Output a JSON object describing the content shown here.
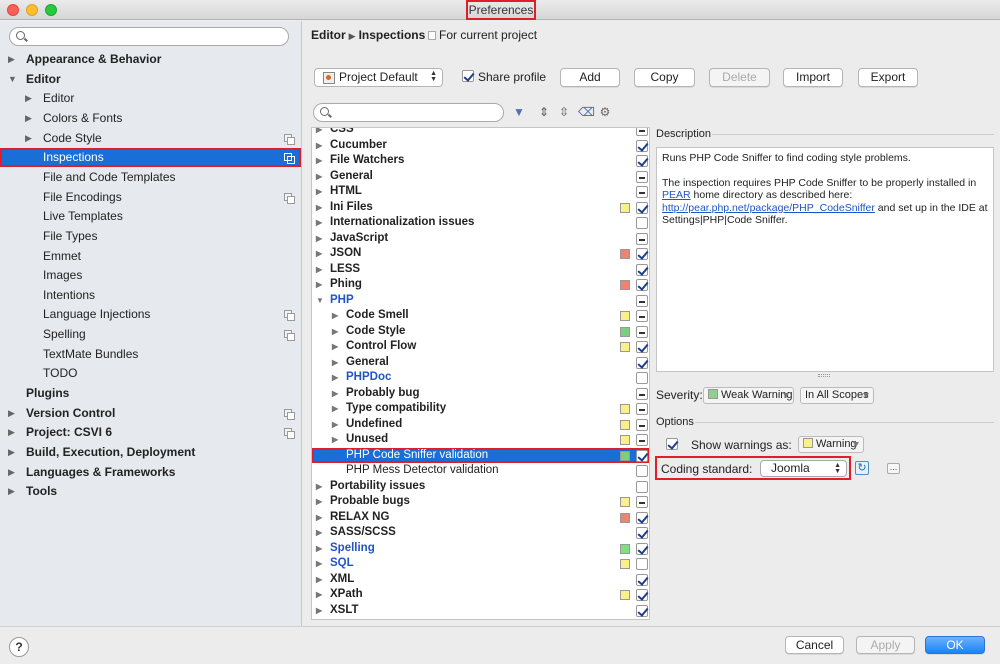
{
  "window": {
    "title": "Preferences"
  },
  "sidebar": {
    "search_placeholder": "",
    "items": [
      {
        "label": "Appearance & Behavior",
        "level": 0,
        "arrow": "▶",
        "bold": true,
        "copy": false,
        "selected": false
      },
      {
        "label": "Editor",
        "level": 0,
        "arrow": "▼",
        "bold": true,
        "copy": false,
        "selected": false
      },
      {
        "label": "Editor",
        "level": 1,
        "arrow": "▶",
        "bold": false,
        "copy": false,
        "selected": false
      },
      {
        "label": "Colors & Fonts",
        "level": 1,
        "arrow": "▶",
        "bold": false,
        "copy": false,
        "selected": false
      },
      {
        "label": "Code Style",
        "level": 1,
        "arrow": "▶",
        "bold": false,
        "copy": true,
        "selected": false
      },
      {
        "label": "Inspections",
        "level": 1,
        "arrow": "",
        "bold": false,
        "copy": true,
        "selected": true
      },
      {
        "label": "File and Code Templates",
        "level": 1,
        "arrow": "",
        "bold": false,
        "copy": false,
        "selected": false
      },
      {
        "label": "File Encodings",
        "level": 1,
        "arrow": "",
        "bold": false,
        "copy": true,
        "selected": false
      },
      {
        "label": "Live Templates",
        "level": 1,
        "arrow": "",
        "bold": false,
        "copy": false,
        "selected": false
      },
      {
        "label": "File Types",
        "level": 1,
        "arrow": "",
        "bold": false,
        "copy": false,
        "selected": false
      },
      {
        "label": "Emmet",
        "level": 1,
        "arrow": "",
        "bold": false,
        "copy": false,
        "selected": false
      },
      {
        "label": "Images",
        "level": 1,
        "arrow": "",
        "bold": false,
        "copy": false,
        "selected": false
      },
      {
        "label": "Intentions",
        "level": 1,
        "arrow": "",
        "bold": false,
        "copy": false,
        "selected": false
      },
      {
        "label": "Language Injections",
        "level": 1,
        "arrow": "",
        "bold": false,
        "copy": true,
        "selected": false
      },
      {
        "label": "Spelling",
        "level": 1,
        "arrow": "",
        "bold": false,
        "copy": true,
        "selected": false
      },
      {
        "label": "TextMate Bundles",
        "level": 1,
        "arrow": "",
        "bold": false,
        "copy": false,
        "selected": false
      },
      {
        "label": "TODO",
        "level": 1,
        "arrow": "",
        "bold": false,
        "copy": false,
        "selected": false
      },
      {
        "label": "Plugins",
        "level": 0,
        "arrow": "",
        "bold": true,
        "copy": false,
        "selected": false
      },
      {
        "label": "Version Control",
        "level": 0,
        "arrow": "▶",
        "bold": true,
        "copy": true,
        "selected": false
      },
      {
        "label": "Project: CSVI 6",
        "level": 0,
        "arrow": "▶",
        "bold": true,
        "copy": true,
        "selected": false
      },
      {
        "label": "Build, Execution, Deployment",
        "level": 0,
        "arrow": "▶",
        "bold": true,
        "copy": false,
        "selected": false
      },
      {
        "label": "Languages & Frameworks",
        "level": 0,
        "arrow": "▶",
        "bold": true,
        "copy": false,
        "selected": false
      },
      {
        "label": "Tools",
        "level": 0,
        "arrow": "▶",
        "bold": true,
        "copy": false,
        "selected": false
      }
    ]
  },
  "header": {
    "breadcrumb_1": "Editor",
    "breadcrumb_sep": "▶",
    "breadcrumb_2": "Inspections",
    "scope_note": "For current project"
  },
  "toolbar": {
    "profile_value": "Project Default",
    "share_profile_label": "Share profile",
    "share_profile_checked": true,
    "add_label": "Add",
    "copy_label": "Copy",
    "delete_label": "Delete",
    "import_label": "Import",
    "export_label": "Export"
  },
  "filter": {
    "placeholder": ""
  },
  "inspections": [
    {
      "label": "CSS",
      "level": 0,
      "arrow": "▶",
      "blue": false,
      "bold": true,
      "sev": "",
      "check": "partial",
      "selected": false
    },
    {
      "label": "Cucumber",
      "level": 0,
      "arrow": "▶",
      "blue": false,
      "bold": true,
      "sev": "",
      "check": "checked",
      "selected": false
    },
    {
      "label": "File Watchers",
      "level": 0,
      "arrow": "▶",
      "blue": false,
      "bold": true,
      "sev": "",
      "check": "checked",
      "selected": false
    },
    {
      "label": "General",
      "level": 0,
      "arrow": "▶",
      "blue": false,
      "bold": true,
      "sev": "",
      "check": "partial",
      "selected": false
    },
    {
      "label": "HTML",
      "level": 0,
      "arrow": "▶",
      "blue": false,
      "bold": true,
      "sev": "",
      "check": "partial",
      "selected": false
    },
    {
      "label": "Ini Files",
      "level": 0,
      "arrow": "▶",
      "blue": false,
      "bold": true,
      "sev": "#f9f08a",
      "check": "checked",
      "selected": false
    },
    {
      "label": "Internationalization issues",
      "level": 0,
      "arrow": "▶",
      "blue": false,
      "bold": true,
      "sev": "",
      "check": "unchecked",
      "selected": false
    },
    {
      "label": "JavaScript",
      "level": 0,
      "arrow": "▶",
      "blue": false,
      "bold": true,
      "sev": "",
      "check": "partial",
      "selected": false
    },
    {
      "label": "JSON",
      "level": 0,
      "arrow": "▶",
      "blue": false,
      "bold": true,
      "sev": "#f08272",
      "check": "checked",
      "selected": false
    },
    {
      "label": "LESS",
      "level": 0,
      "arrow": "▶",
      "blue": false,
      "bold": true,
      "sev": "",
      "check": "checked",
      "selected": false
    },
    {
      "label": "Phing",
      "level": 0,
      "arrow": "▶",
      "blue": false,
      "bold": true,
      "sev": "#f08272",
      "check": "checked",
      "selected": false
    },
    {
      "label": "PHP",
      "level": 0,
      "arrow": "▼",
      "blue": true,
      "bold": true,
      "sev": "",
      "check": "partial",
      "selected": false
    },
    {
      "label": "Code Smell",
      "level": 1,
      "arrow": "▶",
      "blue": false,
      "bold": true,
      "sev": "#f9f08a",
      "check": "partial",
      "selected": false
    },
    {
      "label": "Code Style",
      "level": 1,
      "arrow": "▶",
      "blue": false,
      "bold": true,
      "sev": "#7dcf7d",
      "check": "partial",
      "selected": false
    },
    {
      "label": "Control Flow",
      "level": 1,
      "arrow": "▶",
      "blue": false,
      "bold": true,
      "sev": "#f9f08a",
      "check": "checked",
      "selected": false
    },
    {
      "label": "General",
      "level": 1,
      "arrow": "▶",
      "blue": false,
      "bold": true,
      "sev": "",
      "check": "checked",
      "selected": false
    },
    {
      "label": "PHPDoc",
      "level": 1,
      "arrow": "▶",
      "blue": true,
      "bold": true,
      "sev": "",
      "check": "unchecked",
      "selected": false
    },
    {
      "label": "Probably bug",
      "level": 1,
      "arrow": "▶",
      "blue": false,
      "bold": true,
      "sev": "",
      "check": "partial",
      "selected": false
    },
    {
      "label": "Type compatibility",
      "level": 1,
      "arrow": "▶",
      "blue": false,
      "bold": true,
      "sev": "#f9f08a",
      "check": "partial",
      "selected": false
    },
    {
      "label": "Undefined",
      "level": 1,
      "arrow": "▶",
      "blue": false,
      "bold": true,
      "sev": "#f9f08a",
      "check": "partial",
      "selected": false
    },
    {
      "label": "Unused",
      "level": 1,
      "arrow": "▶",
      "blue": false,
      "bold": true,
      "sev": "#f9f08a",
      "check": "partial",
      "selected": false
    },
    {
      "label": "PHP Code Sniffer validation",
      "level": 1,
      "arrow": "",
      "blue": false,
      "bold": false,
      "sev": "#7dcf7d",
      "check": "checked",
      "selected": true
    },
    {
      "label": "PHP Mess Detector validation",
      "level": 1,
      "arrow": "",
      "blue": false,
      "bold": false,
      "sev": "",
      "check": "unchecked",
      "selected": false
    },
    {
      "label": "Portability issues",
      "level": 0,
      "arrow": "▶",
      "blue": false,
      "bold": true,
      "sev": "",
      "check": "unchecked",
      "selected": false
    },
    {
      "label": "Probable bugs",
      "level": 0,
      "arrow": "▶",
      "blue": false,
      "bold": true,
      "sev": "#f9f08a",
      "check": "partial",
      "selected": false
    },
    {
      "label": "RELAX NG",
      "level": 0,
      "arrow": "▶",
      "blue": false,
      "bold": true,
      "sev": "#f08272",
      "check": "checked",
      "selected": false
    },
    {
      "label": "SASS/SCSS",
      "level": 0,
      "arrow": "▶",
      "blue": false,
      "bold": true,
      "sev": "",
      "check": "checked",
      "selected": false
    },
    {
      "label": "Spelling",
      "level": 0,
      "arrow": "▶",
      "blue": true,
      "bold": true,
      "sev": "#7ee07e",
      "check": "checked",
      "selected": false
    },
    {
      "label": "SQL",
      "level": 0,
      "arrow": "▶",
      "blue": true,
      "bold": true,
      "sev": "#f9f08a",
      "check": "unchecked",
      "selected": false
    },
    {
      "label": "XML",
      "level": 0,
      "arrow": "▶",
      "blue": false,
      "bold": true,
      "sev": "",
      "check": "checked",
      "selected": false
    },
    {
      "label": "XPath",
      "level": 0,
      "arrow": "▶",
      "blue": false,
      "bold": true,
      "sev": "#f9f08a",
      "check": "checked",
      "selected": false
    },
    {
      "label": "XSLT",
      "level": 0,
      "arrow": "▶",
      "blue": false,
      "bold": true,
      "sev": "",
      "check": "checked",
      "selected": false
    }
  ],
  "description": {
    "title": "Description",
    "p1": "Runs PHP Code Sniffer to find coding style problems.",
    "p2_a": "The inspection requires PHP Code Sniffer to be properly installed in ",
    "p2_link1": "PEAR",
    "p2_b": " home directory as described here: ",
    "p2_link2": "http://pear.php.net/package/PHP_CodeSniffer",
    "p2_c": " and set up in the IDE at Settings|PHP|Code Sniffer."
  },
  "severity": {
    "label": "Severity:",
    "value": "Weak Warning",
    "color": "#8fd08f",
    "scope": "In All Scopes"
  },
  "options": {
    "title": "Options",
    "show_warnings_label": "Show warnings as:",
    "show_warnings_checked": true,
    "warning_value": "Warning",
    "warning_color": "#f9f08a",
    "coding_standard_label": "Coding standard:",
    "coding_standard_value": "Joomla",
    "more_label": "..."
  },
  "footer": {
    "help_label": "?",
    "cancel_label": "Cancel",
    "apply_label": "Apply",
    "ok_label": "OK"
  }
}
